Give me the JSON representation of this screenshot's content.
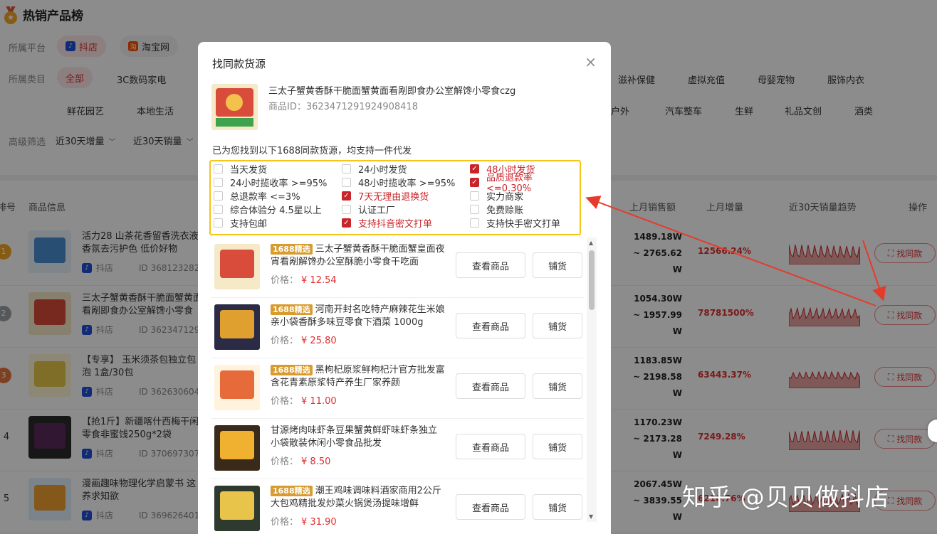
{
  "page": {
    "title": "热销产品榜",
    "platform_label": "所属平台",
    "platforms": [
      "抖店",
      "淘宝网"
    ],
    "category_label": "所属类目",
    "categories_row1": [
      "全部",
      "3C数码家电",
      "滋补保健",
      "虚拟充值",
      "母婴宠物",
      "服饰内衣"
    ],
    "categories_row2": [
      "鲜花园艺",
      "本地生活",
      "户外",
      "汽车整车",
      "生鲜",
      "礼品文创",
      "酒类"
    ],
    "advanced_label": "高级筛选",
    "advanced_filters": [
      "近30天增量",
      "近30天销量"
    ],
    "headers": {
      "rank": "排号",
      "info": "商品信息",
      "last_sales": "上月销售额",
      "last_growth": "上月增量",
      "trend": "近30天销量趋势",
      "op": "操作"
    },
    "find_label": "找同款",
    "rows": [
      {
        "rank": "1",
        "name": "活力28 山茶花香留香洗衣液香氛去污护色 低价好物",
        "platform": "抖店",
        "id": "ID 368123282",
        "sales_top": "1489.18W",
        "sales_mid": "~ 2765.62",
        "sales_unit": "W",
        "growth": "12566.24%"
      },
      {
        "rank": "2",
        "name": "三太子蟹黄香酥干脆面蟹黄面看剐即食办公室解馋小零食czg",
        "platform": "抖店",
        "id": "ID 362347129",
        "sales_top": "1054.30W",
        "sales_mid": "~ 1957.99",
        "sales_unit": "W",
        "growth": "78781500%"
      },
      {
        "rank": "3",
        "name": "【专享】 玉米须茶包独立包泡 1盒/30包",
        "platform": "抖店",
        "id": "ID 362630604",
        "sales_top": "1183.85W",
        "sales_mid": "~ 2198.58",
        "sales_unit": "W",
        "growth": "63443.37%"
      },
      {
        "rank": "4",
        "name": "【抢1斤】新疆喀什西梅干闲零食非蜜饯250g*2袋",
        "platform": "抖店",
        "id": "ID 370697307",
        "sales_top": "1170.23W",
        "sales_mid": "~ 2173.28",
        "sales_unit": "W",
        "growth": "7249.28%"
      },
      {
        "rank": "5",
        "name": "漫画趣味物理化学启蒙书 这养求知欲",
        "platform": "抖店",
        "id": "ID 369626401",
        "sales_top": "2067.45W",
        "sales_mid": "~ 3839.55",
        "sales_unit": "W",
        "growth": "6216.76%"
      }
    ]
  },
  "modal": {
    "title": "找同款货源",
    "close_icon": "×",
    "source_name": "三太子蟹黄香酥干脆面蟹黄面看剐即食办公室解馋小零食czg",
    "source_id": "商品ID：3623471291924908418",
    "found_text": "已为您找到以下1688同款货源，均支持一件代发",
    "options": [
      {
        "label": "当天发货",
        "checked": false
      },
      {
        "label": "24小时发货",
        "checked": false
      },
      {
        "label": "48小时发货",
        "checked": true
      },
      {
        "label": "24小时揽收率 >=95%",
        "checked": false
      },
      {
        "label": "48小时揽收率 >=95%",
        "checked": false
      },
      {
        "label": "品质退款率 <=0.30%",
        "checked": true
      },
      {
        "label": "总退款率 <=3%",
        "checked": false
      },
      {
        "label": "7天无理由退换货",
        "checked": true
      },
      {
        "label": "实力商家",
        "checked": false
      },
      {
        "label": "综合体验分 4.5星以上",
        "checked": false
      },
      {
        "label": "认证工厂",
        "checked": false
      },
      {
        "label": "免费赊账",
        "checked": false
      },
      {
        "label": "支持包邮",
        "checked": false
      },
      {
        "label": "支持抖音密文打单",
        "checked": true
      },
      {
        "label": "支持快手密文打单",
        "checked": false
      }
    ],
    "badge": "1688精选",
    "price_label": "价格：",
    "view_label": "查看商品",
    "dist_label": "铺货",
    "items": [
      {
        "badge": true,
        "name": "三太子蟹黄香酥干脆面蟹皇面夜宵看剐解馋办公室酥脆小零食干吃面",
        "price": "¥ 12.54"
      },
      {
        "badge": true,
        "name": "河南开封名吃特产麻辣花生米娘亲小袋香酥多味豆零食下酒菜 1000g",
        "price": "¥ 25.80"
      },
      {
        "badge": true,
        "name": "黑枸杞原浆鲜枸杞汁官方批发富含花青素原浆特产养生厂家养颜",
        "price": "¥ 11.00"
      },
      {
        "badge": false,
        "name": "甘源烤肉味虾条豆果蟹黄鲜虾味虾条独立小袋散装休闲小零食品批发",
        "price": "¥ 8.50"
      },
      {
        "badge": true,
        "name": "潮王鸡味调味料酒家商用2公斤大包鸡精批发炒菜火锅煲汤提味增鲜",
        "price": "¥ 31.90"
      }
    ]
  },
  "watermark": "知乎 @贝贝做抖店",
  "colors": {
    "accent": "#e02e2e",
    "checked": "#c8252a",
    "highlight": "#f5c518",
    "badge": "#d89b2e"
  }
}
